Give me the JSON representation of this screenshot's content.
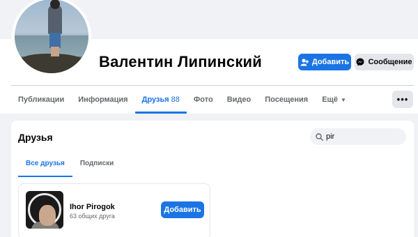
{
  "profile": {
    "name": "Валентин Липинский",
    "add_friend_label": "Добавить",
    "message_label": "Сообщение",
    "more_label": "•••"
  },
  "nav": {
    "tabs": [
      {
        "label": "Публикации"
      },
      {
        "label": "Информация"
      },
      {
        "label": "Друзья",
        "count": "88"
      },
      {
        "label": "Фото"
      },
      {
        "label": "Видео"
      },
      {
        "label": "Посещения"
      },
      {
        "label": "Ещё"
      }
    ]
  },
  "friends": {
    "title": "Друзья",
    "search_value": "pir",
    "subtabs": [
      "Все друзья",
      "Подписки"
    ],
    "items": [
      {
        "name": "Ihor Pirogok",
        "mutual": "63 общих друга",
        "button_label": "Добавить"
      }
    ]
  },
  "colors": {
    "accent": "#1b74e4",
    "background": "#f0f2f5"
  }
}
